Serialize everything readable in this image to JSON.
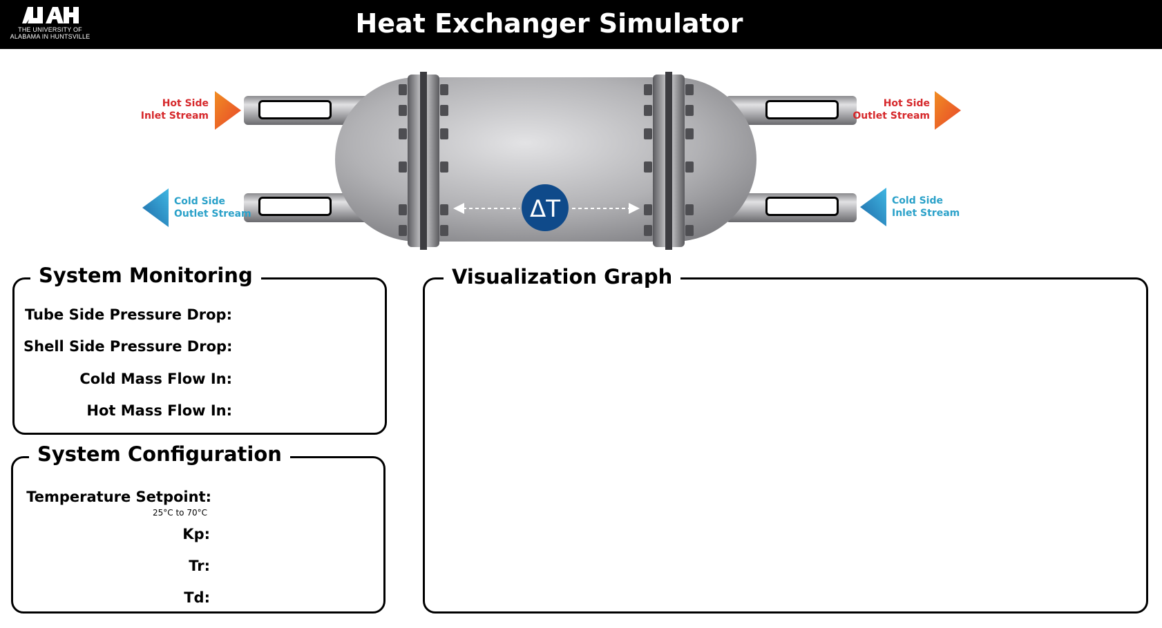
{
  "header": {
    "logo_text": "THE UNIVERSITY OF ALABAMA IN HUNTSVILLE",
    "title": "Heat Exchanger Simulator",
    "background": "#000000"
  },
  "diagram": {
    "hot_inlet": {
      "label_line1": "Hot Side",
      "label_line2": "Inlet Stream",
      "value": ""
    },
    "hot_outlet": {
      "label_line1": "Hot Side",
      "label_line2": "Outlet Stream",
      "value": ""
    },
    "cold_outlet": {
      "label_line1": "Cold Side",
      "label_line2": "Outlet Stream",
      "value": ""
    },
    "cold_inlet": {
      "label_line1": "Cold Side",
      "label_line2": "Inlet Stream",
      "value": ""
    },
    "delta_t": "ΔT",
    "colors": {
      "hot": "#d6282b",
      "cold": "#2aa1c9",
      "delta_badge": "#0f4a8a"
    }
  },
  "monitoring": {
    "title": "System Monitoring",
    "fields": [
      {
        "label": "Tube Side Pressure Drop:",
        "value": ""
      },
      {
        "label": "Shell Side Pressure Drop:",
        "value": ""
      },
      {
        "label": "Cold Mass Flow In:",
        "value": ""
      },
      {
        "label": "Hot Mass Flow In:",
        "value": ""
      }
    ]
  },
  "configuration": {
    "title": "System Configuration",
    "setpoint_label": "Temperature Setpoint:",
    "setpoint_hint": "25°C to 70°C",
    "setpoint_value": "",
    "kp_label": "Kp:",
    "kp_value": "",
    "tr_label": "Tr:",
    "tr_value": "",
    "td_label": "Td:",
    "td_value": ""
  },
  "graph": {
    "title": "Visualization Graph"
  }
}
